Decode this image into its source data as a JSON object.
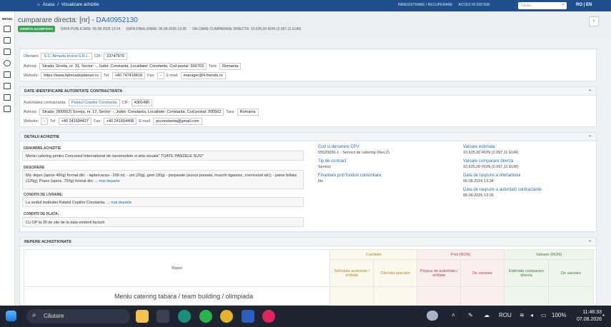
{
  "topbar": {
    "home": "Acasa",
    "sep": "/",
    "page": "Vizualizare achizitie",
    "register": "INREGISTRARE / RECUPERARE",
    "login": "ACCES IN SISTEM",
    "search_placeholder": "Cauta...",
    "lang": "RO | EN"
  },
  "sidebar": {
    "menu_label": "MENIU"
  },
  "header": {
    "title_prefix": "cumparare directa: [nr] - ",
    "title_id": "DA40952130",
    "badge": "OFERTA ACCEPTATA",
    "published": "DATA PUBLICARE: 06.08.2026 13:24",
    "finalized": "DATA FINALIZARE: 06.08.2026 13:35",
    "value": "VALOARE CUMPARARE DIRECTA: 10.625,00 RON (2.097,11 EUR)"
  },
  "ofertant": {
    "label": "Ofertant:",
    "name": "S.C. Almada Invest S.R.L.",
    "cif_label": "CIF:",
    "cif": "23747979",
    "address_label": "Adresa:",
    "address": "Strada: Grivita, nr. 31, Sector: -, Judet: Constanta, Localitate: Constanta, Cod postal: 900703",
    "country_label": "Tara:",
    "country": "Romania",
    "website_label": "Website:",
    "website": "https://www.fabricadeplatouri.ro",
    "tel_label": "Tel:",
    "tel": "+40 747418418",
    "fax_label": "Fax:",
    "fax": "-",
    "email_label": "E-mail:",
    "email": "manager@4-friends.ro"
  },
  "autoritate": {
    "heading": "DATE IDENTIFICARE AUTORITATE CONTRACTANTA",
    "label": "Autoritatea contractanta:",
    "name": "Palatul Copiilor Constanta",
    "cif_label": "CIF:",
    "cif": "4301480",
    "address_label": "Adresa:",
    "address": "Strada: (900562) Soveja, nr. 17, Sector: -, Judet: Constanta, Localitate: Constanta, Cod postal: 900562",
    "country_label": "Tara:",
    "country": "Romania",
    "website_label": "Website:",
    "website": "-",
    "tel_label": "Tel:",
    "tel": "+40 241694427",
    "fax_label": "Fax:",
    "fax": "+40 241654408",
    "email_label": "E-mail:",
    "email": "pcconstanta@gmail.com"
  },
  "detalii": {
    "heading": "DETALII ACHIZITIE",
    "denumire_label": "DENUMIRE ACHIZITIE",
    "denumire": "Meniu catering pentru Concursul International de navomodele si arta vizuala\" TOATE PANZELE SUS!\"",
    "descriere_label": "DESCRIERE",
    "descriere": "Mic dejun (aprox 400g) format din: - lapte/cacao - 200 ml; - unt (20g), gem (30g) - preparate (sunca presata, muschi tiganesc, cremvursti etc); - paine feliata (125g); Pranz (aprox. 750g) format din: ... ",
    "descriere_more": "mai departe",
    "livrare_label": "CONDITII DE LIVRARE:",
    "livrare": "La sediul institutiei Palatul Copiilor Constanta, ... ",
    "livrare_more": "mai departe",
    "plata_label": "CONDITII DE PLATA:",
    "plata": "Cu OP la 30 de zile de la data emiterii facturii",
    "cpv_label": "Cod si denumire CPV",
    "cpv": "55520000-1 - Servicii de catering (Rev.2)",
    "tip_label": "Tip de contract",
    "tip": "Servicii",
    "fonduri_label": "Finantare prin fonduri comunitare",
    "fonduri": "Nu",
    "estimata_label": "Valoare estimata",
    "estimata": "10.625,00 RON (2.097,11 EUR)",
    "cumparare_label": "Valoare cumparare directa",
    "cumparare": "10.625,00 RON (2.097,11 EUR)",
    "raspuns_ofertant_label": "Data de raspuns a ofertantului",
    "raspuns_ofertant": "06.08.2026 13:34",
    "raspuns_autoritate_label": "Data de raspuns a autoritatii contractante",
    "raspuns_autoritate": "06.08.2026 13:35"
  },
  "repere": {
    "heading": "REPERE ACHIZITIONATE",
    "col_reper": "Reper",
    "group_cantitate": "Cantitate",
    "group_pret": "Pret (RON)",
    "group_valoare": "Valoare (RON)",
    "solicitata": "Solicitata autoritate / entitate",
    "ofertata": "Ofertata operator",
    "propus": "Propus de autoritate / entitate",
    "vanzare_pret": "De vanzare",
    "estimata": "Estimata cumparare directa",
    "vanzare_val": "De vanzare",
    "row1": "Meniu catering tabara / team building / olimpiada"
  },
  "taskbar": {
    "search": "Căutare",
    "lang": "ROU",
    "battery": "100%",
    "time": "11:46:33",
    "date": "07.08.2026"
  }
}
